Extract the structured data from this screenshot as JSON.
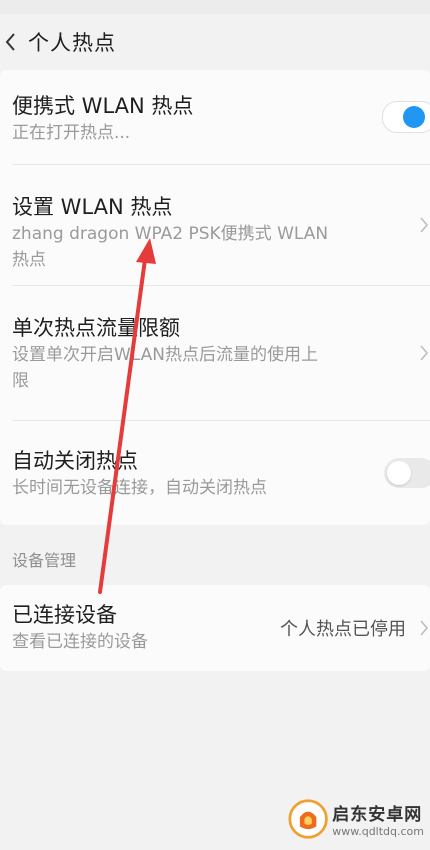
{
  "header": {
    "title": "个人热点"
  },
  "rows": {
    "portable": {
      "title": "便携式 WLAN 热点",
      "subtitle": "正在打开热点..."
    },
    "setup": {
      "title": "设置 WLAN 热点",
      "subtitle_line1": "zhang dragon WPA2 PSK便携式 WLAN",
      "subtitle_line2": "热点"
    },
    "limit": {
      "title": "单次热点流量限额",
      "subtitle_line1": "设置单次开启WLAN热点后流量的使用上",
      "subtitle_line2": "限"
    },
    "autoclose": {
      "title": "自动关闭热点",
      "subtitle": "长时间无设备连接，自动关闭热点"
    },
    "connected": {
      "title": "已连接设备",
      "subtitle": "查看已连接的设备",
      "value": "个人热点已停用"
    }
  },
  "sections": {
    "device_mgmt": "设备管理"
  },
  "toggles": {
    "portable_on": true,
    "autoclose_on": false
  },
  "watermark": {
    "name": "启东安卓网",
    "url": "www.qdltdq.com"
  },
  "colors": {
    "accent": "#2196f3",
    "arrow": "#e63b3b"
  },
  "icons": {
    "back": "chevron-left-icon",
    "chevron": "chevron-right-icon"
  }
}
